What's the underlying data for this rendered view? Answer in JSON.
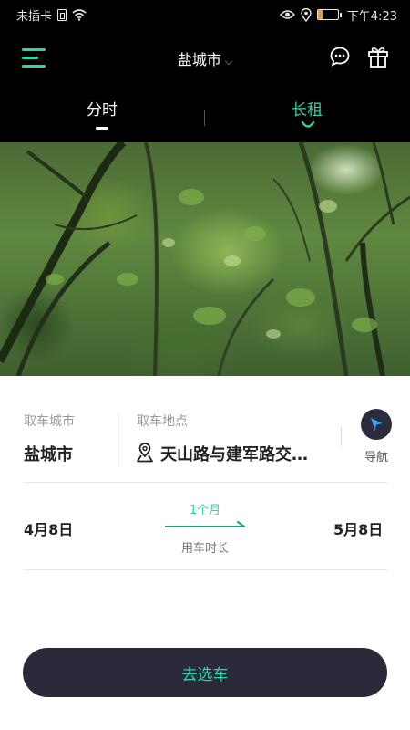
{
  "status_bar": {
    "carrier": "未插卡",
    "battery_level": "16",
    "time": "下午4:23",
    "icons": [
      "sim-card-icon",
      "wifi-icon",
      "eye-icon",
      "location-icon",
      "battery-icon"
    ],
    "battery_color": "#f0a020"
  },
  "header": {
    "city": "盐城市",
    "icons": [
      "menu-icon",
      "chevron-down-icon",
      "message-icon",
      "gift-icon"
    ],
    "accent_color": "#2ed6a6"
  },
  "tabs": [
    {
      "label": "分时",
      "active": false
    },
    {
      "label": "长租",
      "active": true
    }
  ],
  "booking": {
    "pickup_city_label": "取车城市",
    "pickup_city": "盐城市",
    "pickup_location_label": "取车地点",
    "pickup_location": "天山路与建军路交…",
    "navigate_label": "导航",
    "start_date": "4月8日",
    "end_date": "5月8日",
    "duration": "1个月",
    "duration_label": "用车时长",
    "submit_label": "去选车"
  }
}
